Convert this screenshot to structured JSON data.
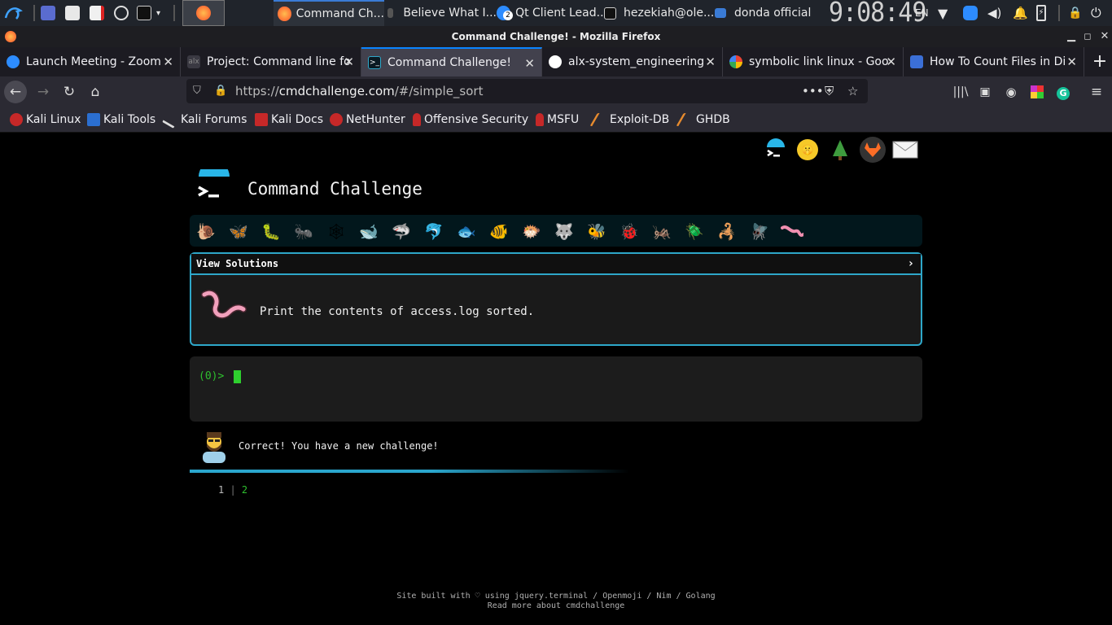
{
  "taskbar": {
    "apps": [
      {
        "name": "Command Ch...",
        "icon": "firefox-icon"
      },
      {
        "name": "Believe What I...",
        "icon": "media-icon"
      },
      {
        "name": "Qt Client Lead...",
        "icon": "zoom-icon",
        "badge": "2"
      },
      {
        "name": "hezekiah@ole...",
        "icon": "terminal-icon"
      },
      {
        "name": "donda official",
        "icon": "folder-icon"
      }
    ],
    "clock": "9:08:49",
    "keyboard_layout": "EN"
  },
  "window": {
    "title": "Command Challenge! - Mozilla Firefox"
  },
  "tabs": [
    {
      "title": "Launch Meeting - Zoom",
      "icon": "zoom-icon",
      "active": false
    },
    {
      "title": "Project: Command line fo",
      "icon": "alx-icon",
      "active": false
    },
    {
      "title": "Command Challenge!",
      "icon": "terminal-icon",
      "active": true
    },
    {
      "title": "alx-system_engineering",
      "icon": "github-icon",
      "active": false
    },
    {
      "title": "symbolic link linux - Goo",
      "icon": "google-icon",
      "active": false
    },
    {
      "title": "How To Count Files in Di",
      "icon": "page-icon",
      "active": false
    }
  ],
  "url": {
    "prefix": "https://",
    "domain": "cmdchallenge.com",
    "path": "/#/simple_sort"
  },
  "bookmarks": [
    {
      "label": "Kali Linux",
      "icon": "kali-icon"
    },
    {
      "label": "Kali Tools",
      "icon": "kali-tools-icon"
    },
    {
      "label": "Kali Forums",
      "icon": "kali-forums-icon"
    },
    {
      "label": "Kali Docs",
      "icon": "kali-docs-icon"
    },
    {
      "label": "NetHunter",
      "icon": "nethunter-icon"
    },
    {
      "label": "Offensive Security",
      "icon": "offsec-icon"
    },
    {
      "label": "MSFU",
      "icon": "msfu-icon"
    },
    {
      "label": "Exploit-DB",
      "icon": "exploitdb-icon"
    },
    {
      "label": "GHDB",
      "icon": "ghdb-icon"
    }
  ],
  "page": {
    "title": "Command Challenge",
    "view_solutions": "View Solutions",
    "task": "Print the contents of access.log sorted.",
    "prompt": "(0)>",
    "message": "Correct! You have a new challenge!",
    "steps": [
      "1",
      "2"
    ],
    "footer_line1": "Site built with ♡ using jquery.terminal / Openmoji / Nim / Golang",
    "footer_line2": "Read more about cmdchallenge"
  },
  "colors": {
    "accent": "#2ea7c9",
    "prompt_green": "#2ec02e",
    "tab_highlight": "#0a84ff"
  }
}
